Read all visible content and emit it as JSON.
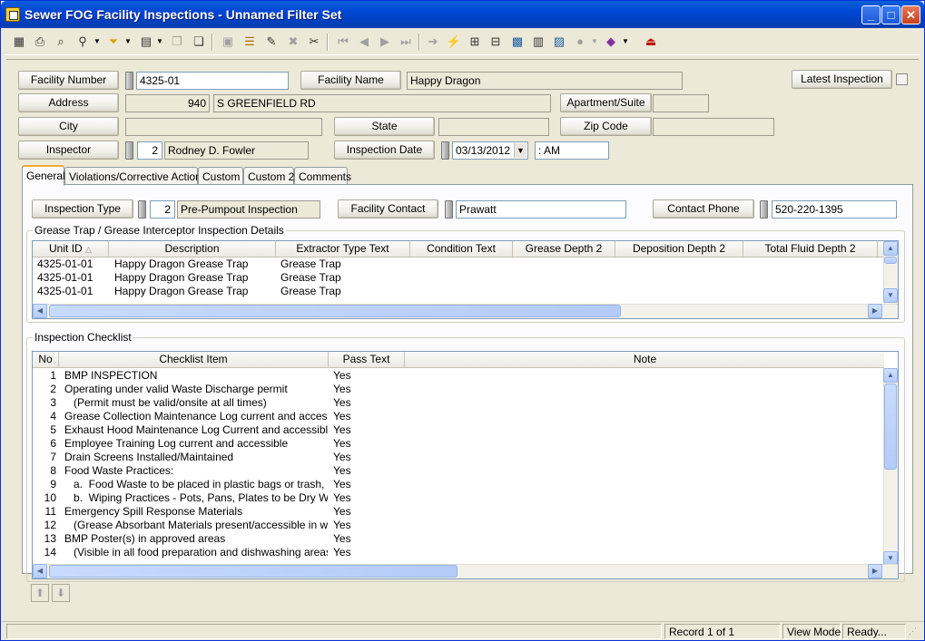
{
  "window": {
    "title": "Sewer FOG Facility Inspections - Unnamed Filter Set",
    "minimize": "_",
    "maximize": "□",
    "close": "✕"
  },
  "toolbar": {
    "icons": [
      "grid-icon",
      "print-icon",
      "print-preview-icon",
      "find-icon",
      "filter-icon",
      "new-record-icon",
      "copy-record-icon",
      "clipboard-icon",
      "save-icon",
      "stack-icon",
      "edit-icon",
      "delete-icon",
      "cut-icon",
      "first-record-icon",
      "previous-record-icon",
      "next-record-icon",
      "last-record-icon",
      "go-icon",
      "lightning-icon",
      "tree-icon",
      "org-chart-icon",
      "map-icon",
      "calculator-icon",
      "map-layers-icon",
      "globe-icon",
      "book-icon",
      "exit-icon"
    ]
  },
  "header": {
    "facility_number_label": "Facility Number",
    "facility_number": "4325-01",
    "facility_name_label": "Facility Name",
    "facility_name": "Happy Dragon",
    "latest_inspection_label": "Latest Inspection",
    "address_label": "Address",
    "address_number": "940",
    "address_street": "S GREENFIELD RD",
    "apartment_label": "Apartment/Suite",
    "apartment": "",
    "city_label": "City",
    "city": "",
    "state_label": "State",
    "state": "",
    "zip_label": "Zip Code",
    "zip": "",
    "inspector_label": "Inspector",
    "inspector_id": "2",
    "inspector_name": "Rodney D. Fowler",
    "inspection_date_label": "Inspection Date",
    "inspection_date": "03/13/2012",
    "inspection_time": " :  AM"
  },
  "tabs": [
    "General",
    "Violations/Corrective Actions",
    "Custom",
    "Custom 2",
    "Comments"
  ],
  "general": {
    "inspection_type_label": "Inspection Type",
    "inspection_type_id": "2",
    "inspection_type": "Pre-Pumpout Inspection",
    "facility_contact_label": "Facility Contact",
    "facility_contact": "Prawatt",
    "contact_phone_label": "Contact Phone",
    "contact_phone": "520-220-1395"
  },
  "grease": {
    "title": "Grease Trap / Grease Interceptor Inspection Details",
    "columns": [
      "Unit ID",
      "Description",
      "Extractor Type Text",
      "Condition Text",
      "Grease Depth 2",
      "Deposition Depth 2",
      "Total Fluid Depth 2"
    ],
    "sort_indicator": "△",
    "rows": [
      [
        "4325-01-01",
        "Happy Dragon Grease Trap",
        "Grease Trap"
      ],
      [
        "4325-01-01",
        "Happy Dragon Grease Trap",
        "Grease Trap"
      ],
      [
        "4325-01-01",
        "Happy Dragon Grease Trap",
        "Grease Trap"
      ]
    ]
  },
  "checklist": {
    "title": "Inspection Checklist",
    "columns": [
      "No",
      "Checklist Item",
      "Pass Text",
      "Note"
    ],
    "rows": [
      [
        "1",
        "BMP INSPECTION",
        "Yes"
      ],
      [
        "2",
        "Operating under valid Waste Discharge permit",
        "Yes"
      ],
      [
        "3",
        "   (Permit must be valid/onsite at all times)",
        "Yes"
      ],
      [
        "4",
        "Grease Collection Maintenance Log current and accessible",
        "Yes"
      ],
      [
        "5",
        "Exhaust Hood Maintenance Log Current and accessible",
        "Yes"
      ],
      [
        "6",
        "Employee Training Log current and accessible",
        "Yes"
      ],
      [
        "7",
        "Drain Screens Installed/Maintained",
        "Yes"
      ],
      [
        "8",
        "Food Waste Practices:",
        "Yes"
      ],
      [
        "9",
        "   a.  Food Waste to be placed in plastic bags or trash, not ri...",
        "Yes"
      ],
      [
        "10",
        "   b.  Wiping Practices - Pots, Pans, Plates to be Dry Wiped",
        "Yes"
      ],
      [
        "11",
        "Emergency Spill Response Materials",
        "Yes"
      ],
      [
        "12",
        "   (Grease Absorbant Materials present/accessible in work a...",
        "Yes"
      ],
      [
        "13",
        "BMP Poster(s) in approved areas",
        "Yes"
      ],
      [
        "14",
        "   (Visible in all food preparation and dishwashing areas)",
        "Yes"
      ]
    ]
  },
  "status": {
    "record": "Record 1 of 1",
    "mode": "View Mode",
    "state": "Ready..."
  }
}
